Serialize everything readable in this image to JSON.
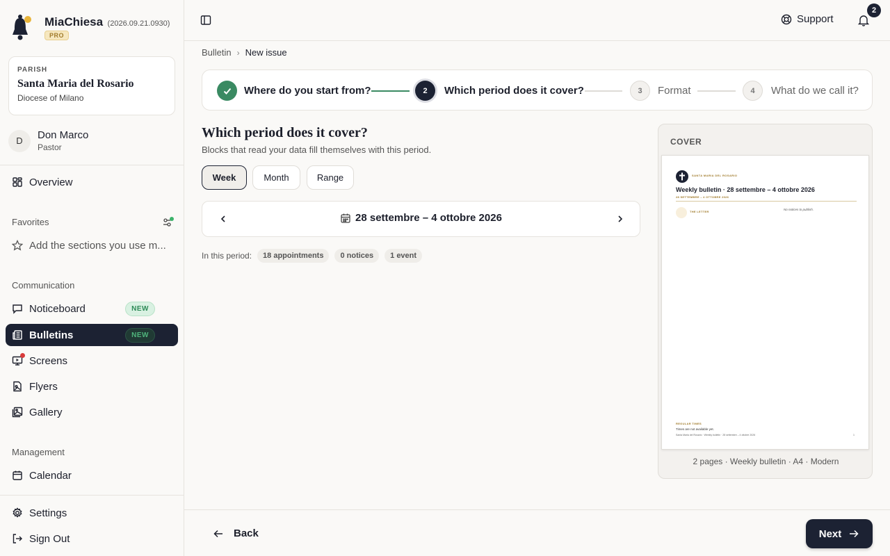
{
  "app": {
    "name": "MiaChiesa",
    "version": "(2026.09.21.0930)",
    "plan": "PRO"
  },
  "parish": {
    "label": "PARISH",
    "name": "Santa Maria del Rosario",
    "diocese": "Diocese of Milano"
  },
  "user": {
    "initial": "D",
    "name": "Don Marco",
    "role": "Pastor"
  },
  "nav": {
    "overview": "Overview",
    "favorites_label": "Favorites",
    "favorites_hint": "Add the sections you use m...",
    "communication_label": "Communication",
    "noticeboard": {
      "label": "Noticeboard",
      "badge": "NEW"
    },
    "bulletins": {
      "label": "Bulletins",
      "badge": "NEW"
    },
    "screens": "Screens",
    "flyers": "Flyers",
    "gallery": "Gallery",
    "management_label": "Management",
    "calendar": "Calendar",
    "settings": "Settings",
    "signout": "Sign Out"
  },
  "topbar": {
    "support": "Support",
    "notifications_count": "2"
  },
  "breadcrumb": {
    "parent": "Bulletin",
    "current": "New issue"
  },
  "stepper": {
    "steps": [
      {
        "num": "",
        "label": "Where do you start from?",
        "state": "done"
      },
      {
        "num": "2",
        "label": "Which period does it cover?",
        "state": "active"
      },
      {
        "num": "3",
        "label": "Format",
        "state": "todo"
      },
      {
        "num": "4",
        "label": "What do we call it?",
        "state": "todo"
      }
    ]
  },
  "main": {
    "heading": "Which period does it cover?",
    "subheading": "Blocks that read your data fill themselves with this period.",
    "period_types": [
      "Week",
      "Month",
      "Range"
    ],
    "selected_period_type": "Week",
    "period_range": "28 settembre – 4 ottobre 2026",
    "stats_label": "In this period:",
    "stats": [
      "18 appointments",
      "0 notices",
      "1 event"
    ]
  },
  "cover": {
    "title": "COVER",
    "page": {
      "parish": "SANTA MARIA DEL ROSARIO",
      "title": "Weekly bulletin · 28 settembre – 4 ottobre 2026",
      "dates": "28 SETTEMBRE – 4 OTTOBRE 2026",
      "letter": "THE LETTER",
      "notices": "No notices to publish.",
      "regular_times": "REGULAR TIMES",
      "times_text": "Times are not available yet.",
      "footer": "Santa Maria del Rosario · Weekly bulletin · 28 settembre – 4 ottobre 2026",
      "page_num": "1"
    },
    "meta": "2 pages · Weekly bulletin · A4 · Modern"
  },
  "footer": {
    "back": "Back",
    "next": "Next"
  },
  "colors": {
    "primary": "#1c2233",
    "success": "#3a8a62",
    "accent_gold": "#a07a2a",
    "badge_green": "#2e8a57",
    "alert_red": "#d93a3a"
  }
}
